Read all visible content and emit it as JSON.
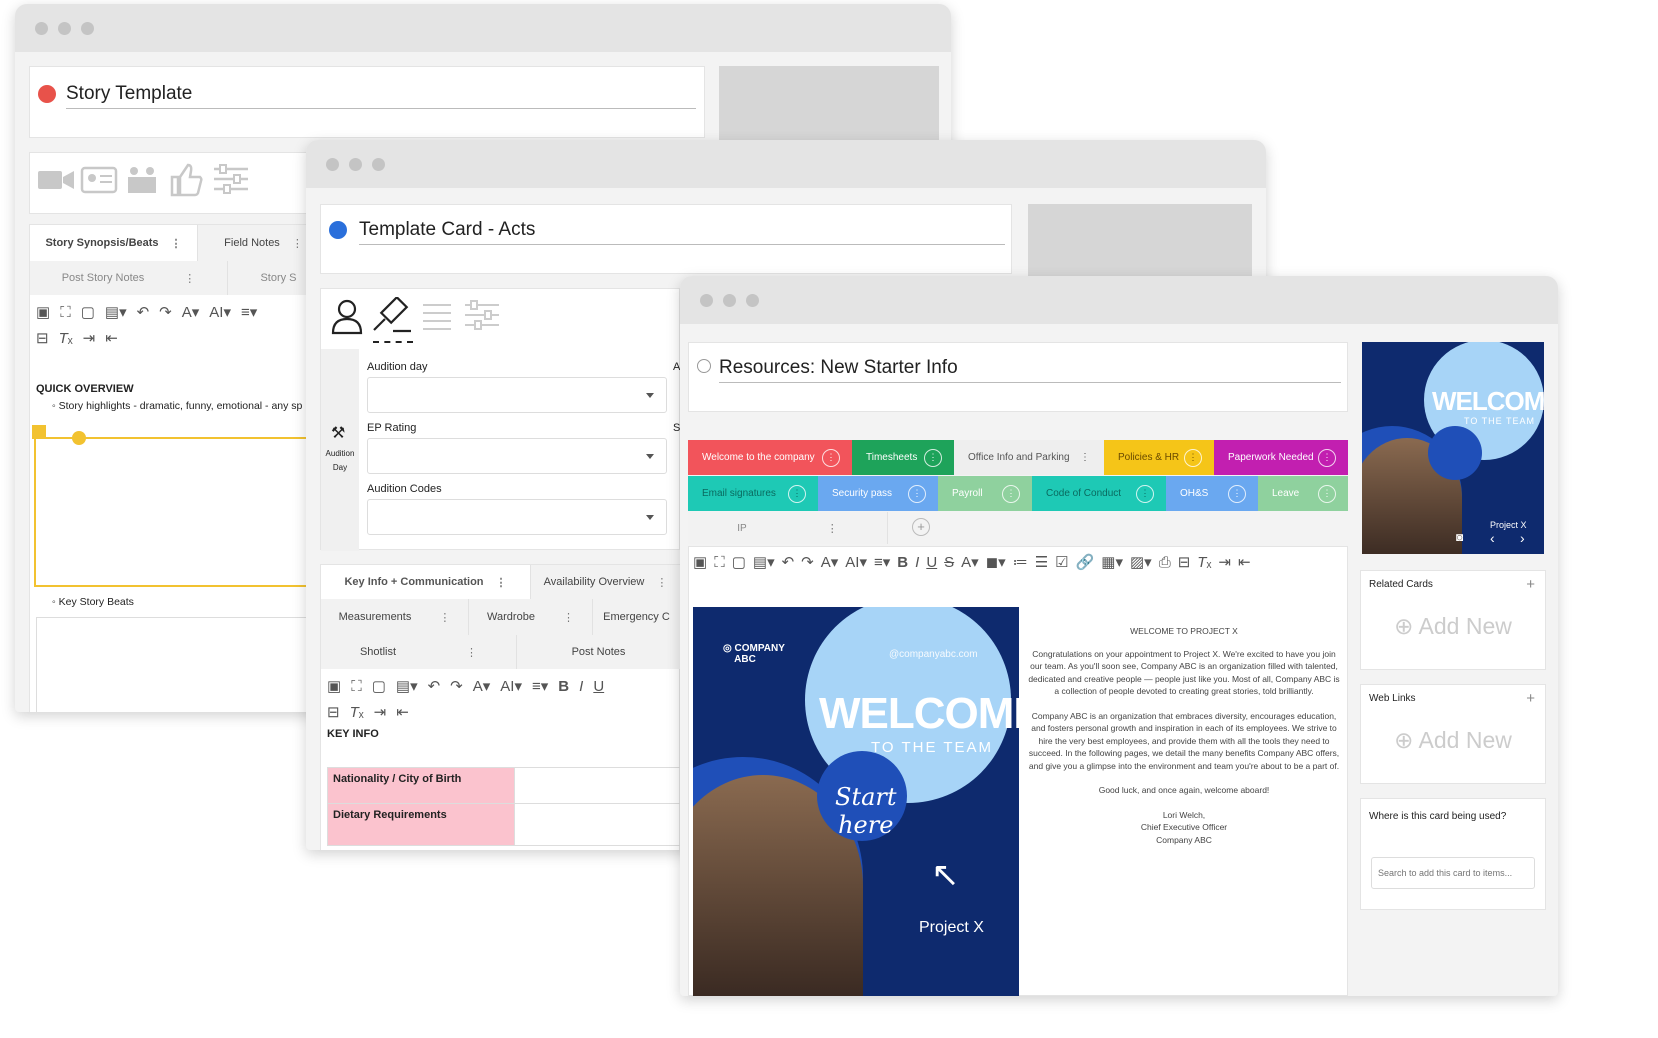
{
  "win1": {
    "title": "Story Template",
    "tabs": [
      "Story Synopsis/Beats",
      "Field Notes"
    ],
    "subtabs": [
      "Post Story Notes",
      "Story S"
    ],
    "heading": "QUICK OVERVIEW",
    "bullet1": "Story highlights - dramatic, funny, emotional - any sp",
    "bullet2": "Key Story Beats"
  },
  "win2": {
    "title": "Template Card - Acts",
    "sidebar_label": "Audition Day",
    "fields": [
      {
        "label": "Audition day"
      },
      {
        "label": "EP Rating"
      },
      {
        "label": "Audition Codes"
      }
    ],
    "right_letters": [
      "A",
      "S"
    ],
    "tabs_row1": [
      "Key Info + Communication",
      "Availability Overview"
    ],
    "tabs_row2": [
      "Measurements",
      "Wardrobe",
      "Emergency C"
    ],
    "tabs_row3": [
      "Shotlist",
      "Post Notes"
    ],
    "key_info": "KEY INFO",
    "table": [
      "Nationality / City of Birth",
      "Dietary Requirements"
    ]
  },
  "win3": {
    "title": "Resources: New Starter Info",
    "tags_row1": [
      {
        "label": "Welcome to the company",
        "color": "#f2545b"
      },
      {
        "label": "Timesheets",
        "color": "#1ea35a"
      },
      {
        "label": "Office Info and Parking",
        "color": "#eeeeee"
      },
      {
        "label": "Policies & HR",
        "color": "#f5c518"
      },
      {
        "label": "Paperwork Needed",
        "color": "#c21fb0"
      }
    ],
    "tags_row2": [
      {
        "label": "Email signatures",
        "color": "#1ec9b5"
      },
      {
        "label": "Security pass",
        "color": "#6aa8f0"
      },
      {
        "label": "Payroll",
        "color": "#8fd19e"
      },
      {
        "label": "Code of Conduct",
        "color": "#1ec9b5"
      },
      {
        "label": "OH&S",
        "color": "#6aa8f0"
      },
      {
        "label": "Leave",
        "color": "#8fd19e"
      }
    ],
    "ip_tab": "IP",
    "letter": {
      "heading": "WELCOME TO PROJECT X",
      "p1": "Congratulations on your appointment to Project X. We're excited to have you join our team. As you'll soon see, Company ABC is an organization filled with talented, dedicated and creative people — people just like you. Most of all, Company ABC is a collection of people devoted to creating great stories, told brilliantly.",
      "p2": "Company ABC is an organization that embraces diversity, encourages education, and fosters personal growth and inspiration in each of its employees. We strive to hire the very best employees, and provide them with all the tools they need to succeed. In the following pages, we detail the many benefits Company ABC offers, and give you a glimpse into the environment and team you're about to be a part of.",
      "p3": "Good luck, and once again, welcome aboard!",
      "sig1": "Lori Welch,",
      "sig2": "Chief Executive Officer",
      "sig3": "Company ABC"
    },
    "poster": {
      "company": "COMPANY",
      "company2": "ABC",
      "handle": "@companyabc.com",
      "welcome": "WELCOME",
      "to_team": "TO THE TEAM",
      "start": "Start",
      "here": "here",
      "project": "Project X"
    },
    "side": {
      "related": "Related Cards",
      "web_links": "Web Links",
      "add_new": "Add New",
      "where_used": "Where is this card being used?",
      "search_placeholder": "Search to add this card to items..."
    }
  }
}
